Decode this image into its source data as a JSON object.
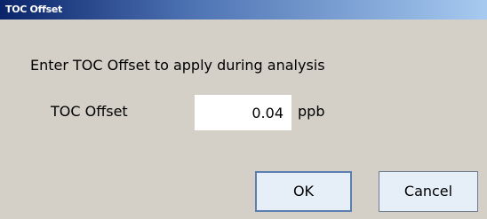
{
  "window": {
    "title": "TOC Offset"
  },
  "dialog": {
    "prompt": "Enter TOC Offset to apply during analysis",
    "field_label": "TOC Offset",
    "field_value": "0.04",
    "unit": "ppb"
  },
  "buttons": {
    "ok_label": "OK",
    "cancel_label": "Cancel"
  },
  "colors": {
    "title_bar_start": "#0a246a",
    "title_bar_end": "#a6caf0",
    "dialog_background": "#d4d0c8",
    "button_face": "#e6eef8"
  }
}
